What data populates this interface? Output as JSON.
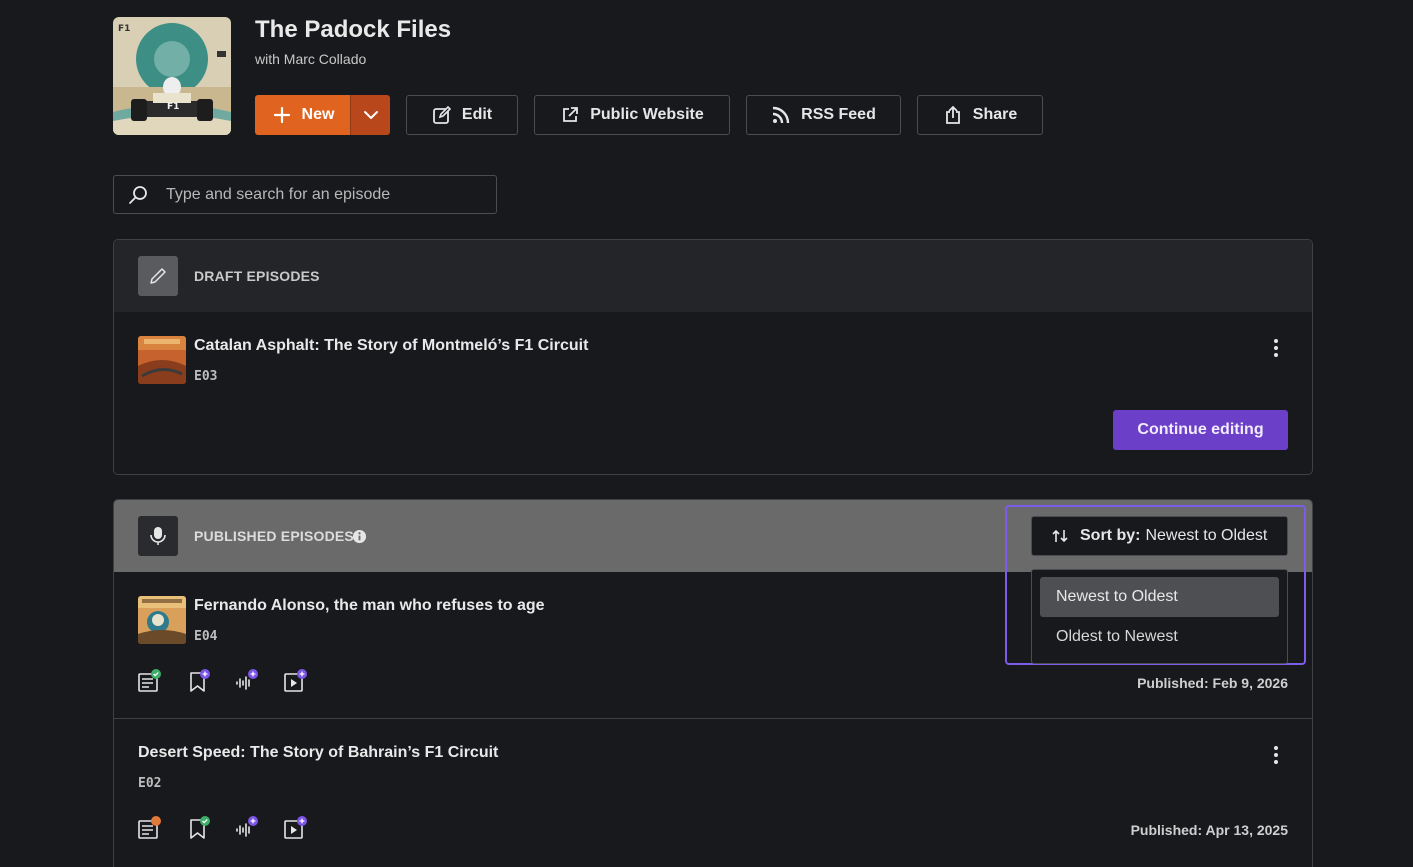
{
  "show": {
    "title": "The Padock Files",
    "host": "with Marc Collado"
  },
  "toolbar": {
    "new_label": "New",
    "edit_label": "Edit",
    "website_label": "Public Website",
    "rss_label": "RSS Feed",
    "share_label": "Share"
  },
  "search": {
    "placeholder": "Type and search for an episode"
  },
  "drafts": {
    "header": "DRAFT EPISODES",
    "episodes": [
      {
        "title": "Catalan Asphalt: The Story of Montmeló’s F1 Circuit",
        "number": "E03",
        "action": "Continue editing"
      }
    ]
  },
  "published": {
    "header": "PUBLISHED EPISODES",
    "sort": {
      "label": "Sort by:",
      "value": "Newest to Oldest",
      "options": [
        "Newest to Oldest",
        "Oldest to Newest"
      ]
    },
    "episodes": [
      {
        "title": "Fernando Alonso, the man who refuses to age",
        "number": "E04",
        "date": "Published: Feb 9, 2026"
      },
      {
        "title": "Desert Speed: The Story of Bahrain’s F1 Circuit",
        "number": "E02",
        "date": "Published: Apr 13, 2025"
      }
    ]
  },
  "colors": {
    "accent_orange": "#e0641f",
    "accent_purple": "#6b3fc8",
    "status_green": "#3fae6a",
    "status_orange": "#e07a3a",
    "badge_purple": "#7d55e6"
  }
}
